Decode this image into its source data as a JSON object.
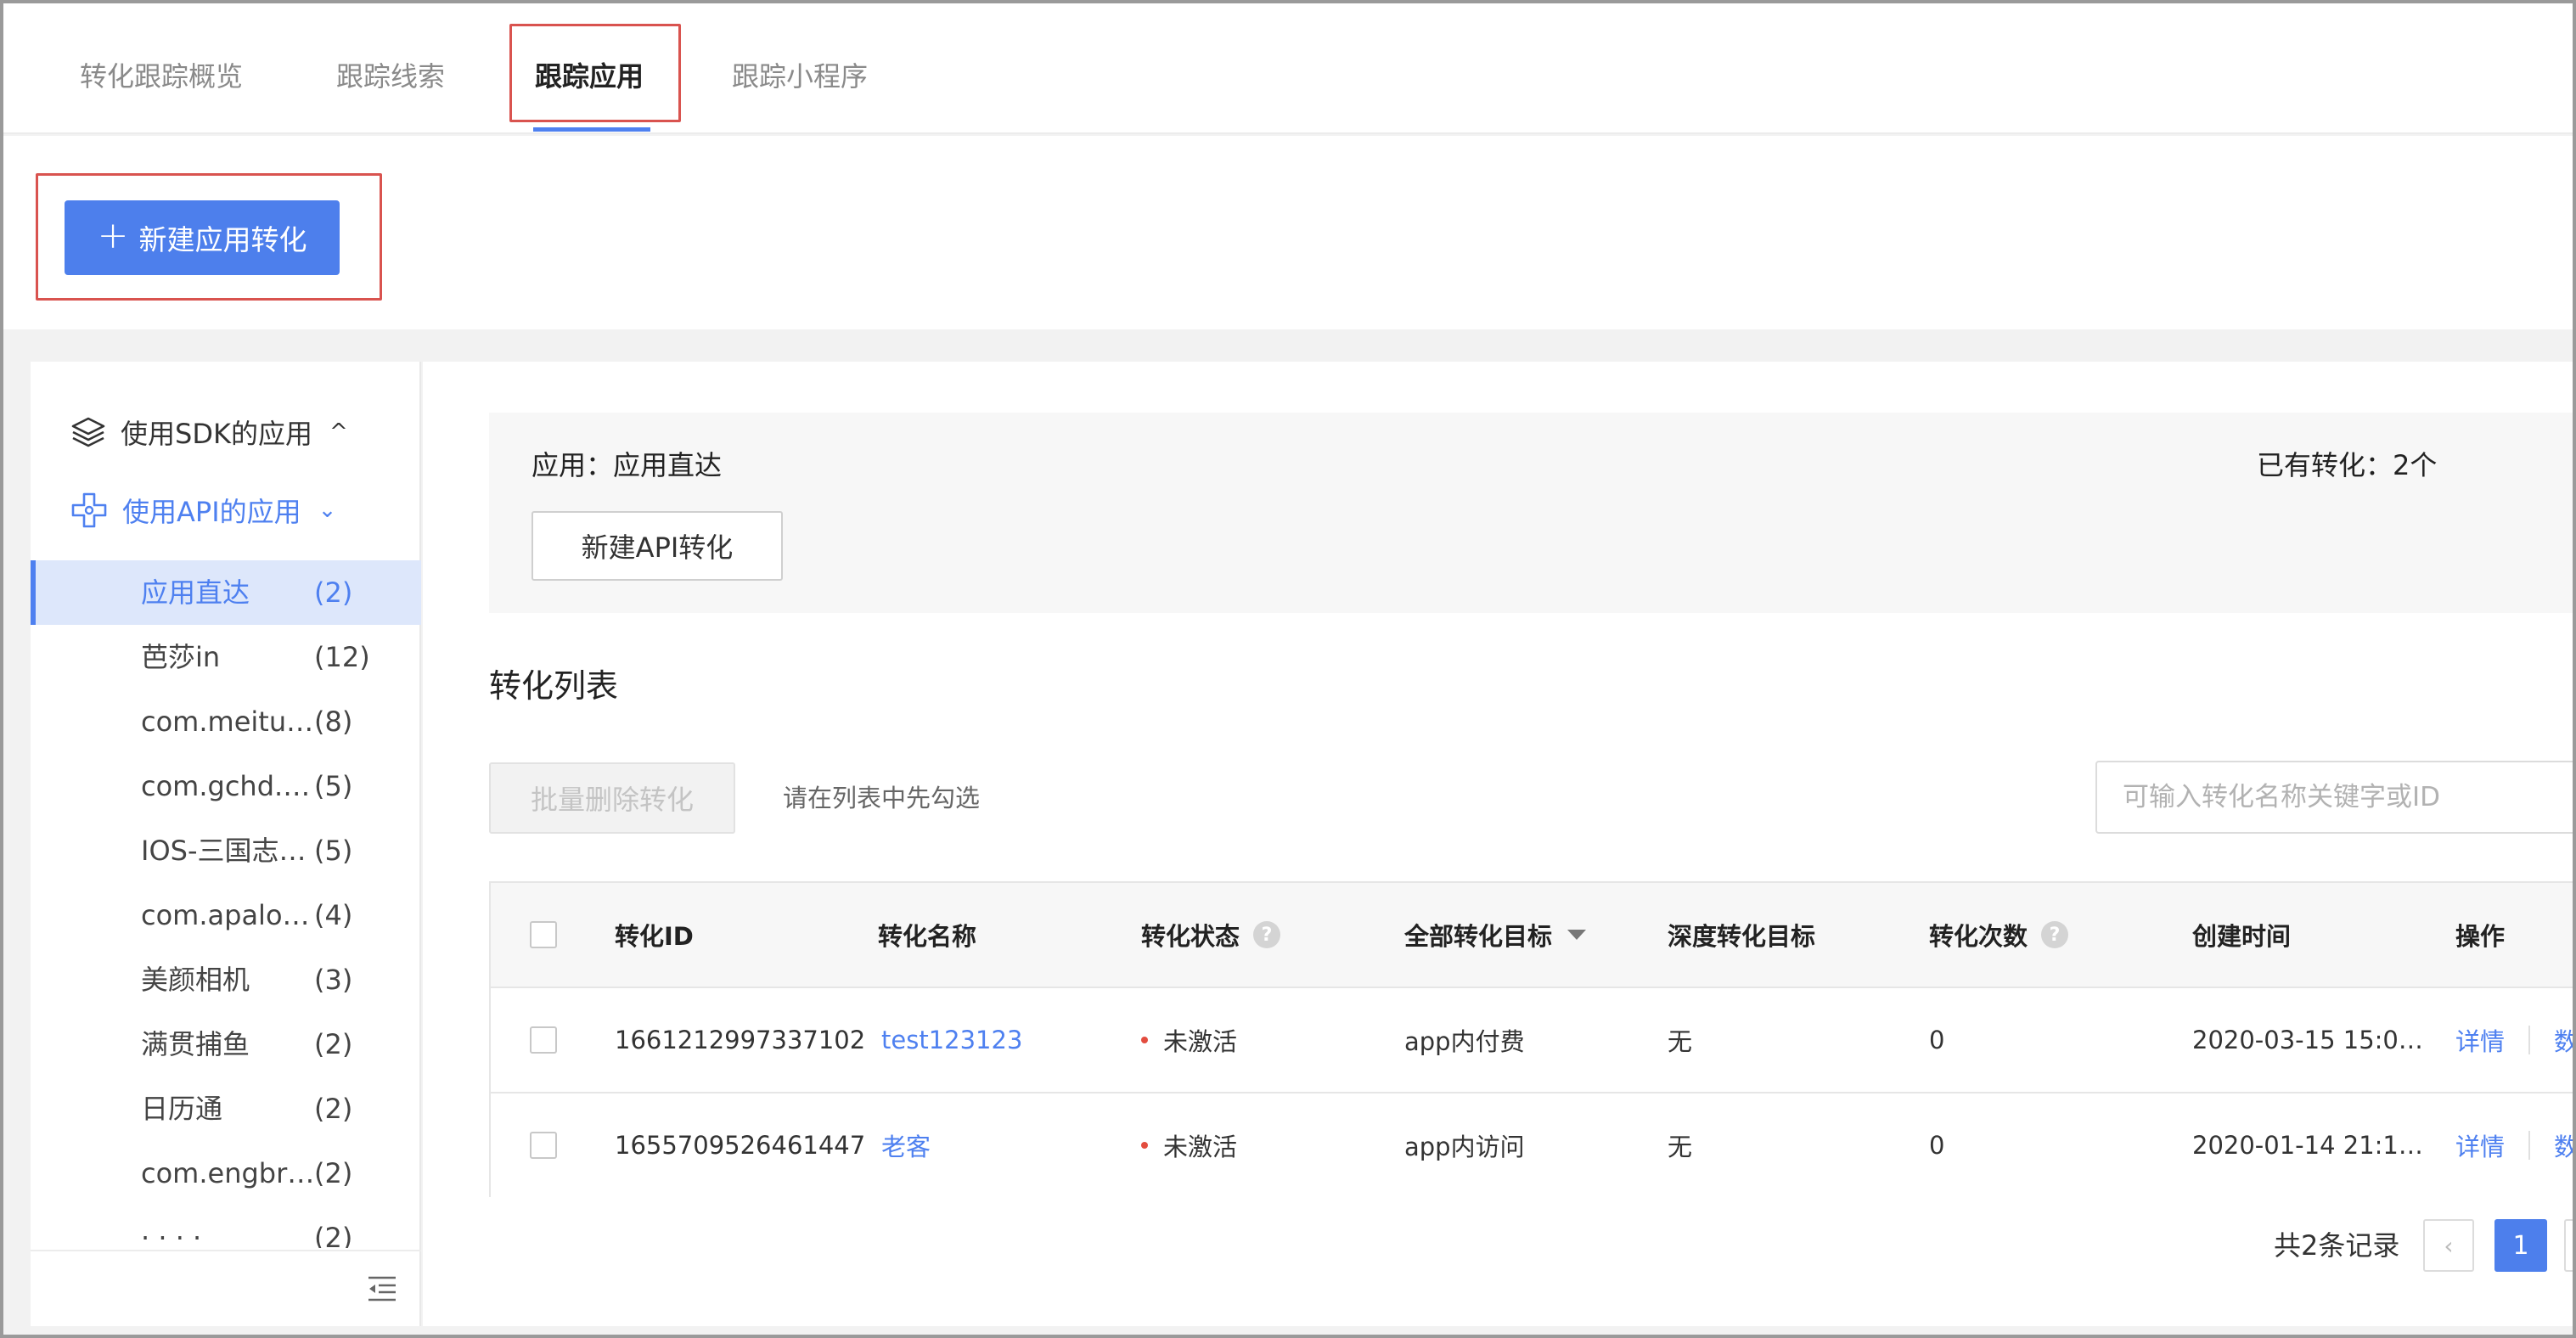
{
  "tabs": [
    {
      "label": "转化跟踪概览",
      "active": false
    },
    {
      "label": "跟踪线索",
      "active": false
    },
    {
      "label": "跟踪应用",
      "active": true
    },
    {
      "label": "跟踪小程序",
      "active": false
    }
  ],
  "toolbar": {
    "new_app_conversion_label": "新建应用转化",
    "plus": "+"
  },
  "sidebar": {
    "sdk_group_label": "使用SDK的应用",
    "api_group_label": "使用API的应用",
    "sdk_chevron": "^",
    "api_chevron": "⌄",
    "apps": [
      {
        "name": "应用直达",
        "count": "(2)",
        "active": true
      },
      {
        "name": "芭莎in",
        "count": "(12)"
      },
      {
        "name": "com.meitu.…",
        "count": "(8)"
      },
      {
        "name": "com.gchd.…",
        "count": "(5)"
      },
      {
        "name": "IOS-三国志…",
        "count": "(5)"
      },
      {
        "name": "com.apalo…",
        "count": "(4)"
      },
      {
        "name": "美颜相机",
        "count": "(3)"
      },
      {
        "name": "满贯捕鱼",
        "count": "(2)"
      },
      {
        "name": "日历通",
        "count": "(2)"
      },
      {
        "name": "com.engbri…",
        "count": "(2)"
      },
      {
        "name": "· · · ·",
        "count": "(2)"
      }
    ]
  },
  "info": {
    "app_label": "应用：应用直达",
    "existing_count": "已有转化：2个",
    "new_api_button": "新建API转化"
  },
  "list": {
    "title": "转化列表",
    "batch_delete_label": "批量删除转化",
    "hint": "请在列表中先勾选",
    "search_placeholder": "可输入转化名称关键字或ID"
  },
  "table": {
    "headers": {
      "id": "转化ID",
      "name": "转化名称",
      "status": "转化状态",
      "target": "全部转化目标",
      "deep_target": "深度转化目标",
      "count": "转化次数",
      "created": "创建时间",
      "ops": "操作"
    },
    "help_glyph": "?",
    "rows": [
      {
        "id": "1661212997337102",
        "name": "test123123",
        "status": "未激活",
        "target": "app内付费",
        "deep_target": "无",
        "count": "0",
        "created": "2020-03-15 15:0…",
        "op_detail": "详情",
        "op_data": "数据"
      },
      {
        "id": "1655709526461447",
        "name": "老客",
        "status": "未激活",
        "target": "app内访问",
        "deep_target": "无",
        "count": "0",
        "created": "2020-01-14 21:1…",
        "op_detail": "详情",
        "op_data": "数据"
      }
    ]
  },
  "pagination": {
    "total_label": "共2条记录",
    "prev": "‹",
    "current": "1"
  },
  "colors": {
    "accent": "#4d7fec",
    "highlight": "#d9534f",
    "status_dot": "#e34d3f"
  }
}
